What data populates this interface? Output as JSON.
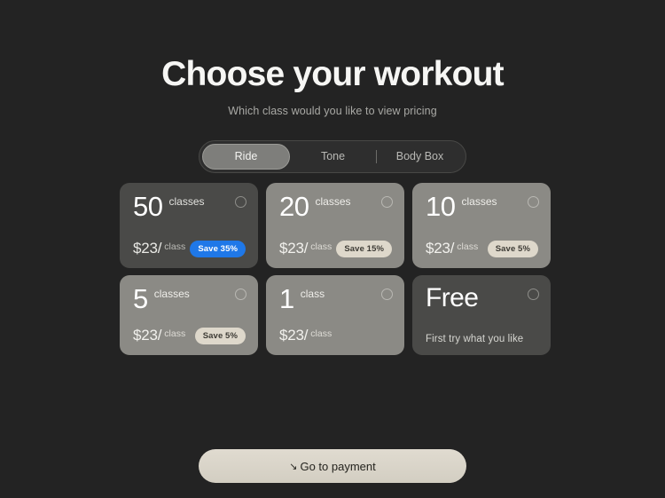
{
  "header": {
    "title": "Choose your workout",
    "subtitle": "Which class would you like to view pricing"
  },
  "tabs": {
    "items": [
      {
        "label": "Ride",
        "selected": true
      },
      {
        "label": "Tone",
        "selected": false
      },
      {
        "label": "Body Box",
        "selected": false
      }
    ]
  },
  "plans": [
    {
      "count": "50",
      "unit": "classes",
      "price": "$23/",
      "price_unit": "class",
      "badge": "Save 35%",
      "badge_style": "blue",
      "card_style": "dark",
      "selected": false
    },
    {
      "count": "20",
      "unit": "classes",
      "price": "$23/",
      "price_unit": "class",
      "badge": "Save 15%",
      "badge_style": "cream",
      "card_style": "light",
      "selected": false
    },
    {
      "count": "10",
      "unit": "classes",
      "price": "$23/",
      "price_unit": "class",
      "badge": "Save 5%",
      "badge_style": "cream",
      "card_style": "light",
      "selected": false
    },
    {
      "count": "5",
      "unit": "classes",
      "price": "$23/",
      "price_unit": "class",
      "badge": "Save 5%",
      "badge_style": "cream",
      "card_style": "light",
      "selected": false
    },
    {
      "count": "1",
      "unit": "class",
      "price": "$23/",
      "price_unit": "class",
      "badge": "",
      "badge_style": "none",
      "card_style": "light",
      "selected": false
    },
    {
      "count": "Free",
      "unit": "",
      "price": "",
      "price_unit": "",
      "description": "First try what you like",
      "badge": "",
      "badge_style": "none",
      "card_style": "dark",
      "selected": false
    }
  ],
  "cta": {
    "label": "Go to payment",
    "arrow_icon": "↘"
  },
  "colors": {
    "background": "#232323",
    "card_dark": "#4a4a48",
    "card_light": "#8b8a85",
    "badge_blue": "#1f78e8",
    "badge_cream": "#ded8cb",
    "cta_cream": "#d9d4c8",
    "tab_selected": "#7e7e7b"
  }
}
